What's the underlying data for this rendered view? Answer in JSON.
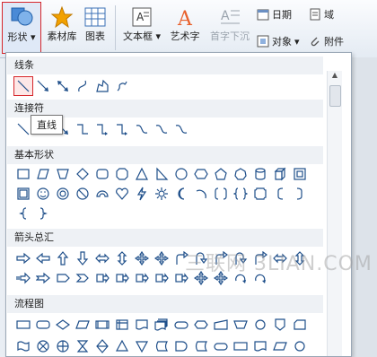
{
  "ribbon": {
    "shapes_label": "形状",
    "material_label": "素材库",
    "chart_label": "图表",
    "textbox_label": "文本框",
    "wordart_label": "艺术字",
    "dropcap_label": "首字下沉",
    "date_label": "日期",
    "field_label": "域",
    "object_label": "对象",
    "attachment_label": "附件"
  },
  "panel": {
    "sections": [
      "线条",
      "连接符",
      "基本形状",
      "箭头总汇",
      "流程图"
    ]
  },
  "tooltip": "直线",
  "watermark": "三联网 3LIAN.COM",
  "colors": {
    "accent_red": "#d6262b",
    "icon_blue": "#2b6cb8",
    "shape_stroke": "#1f4f8a"
  }
}
